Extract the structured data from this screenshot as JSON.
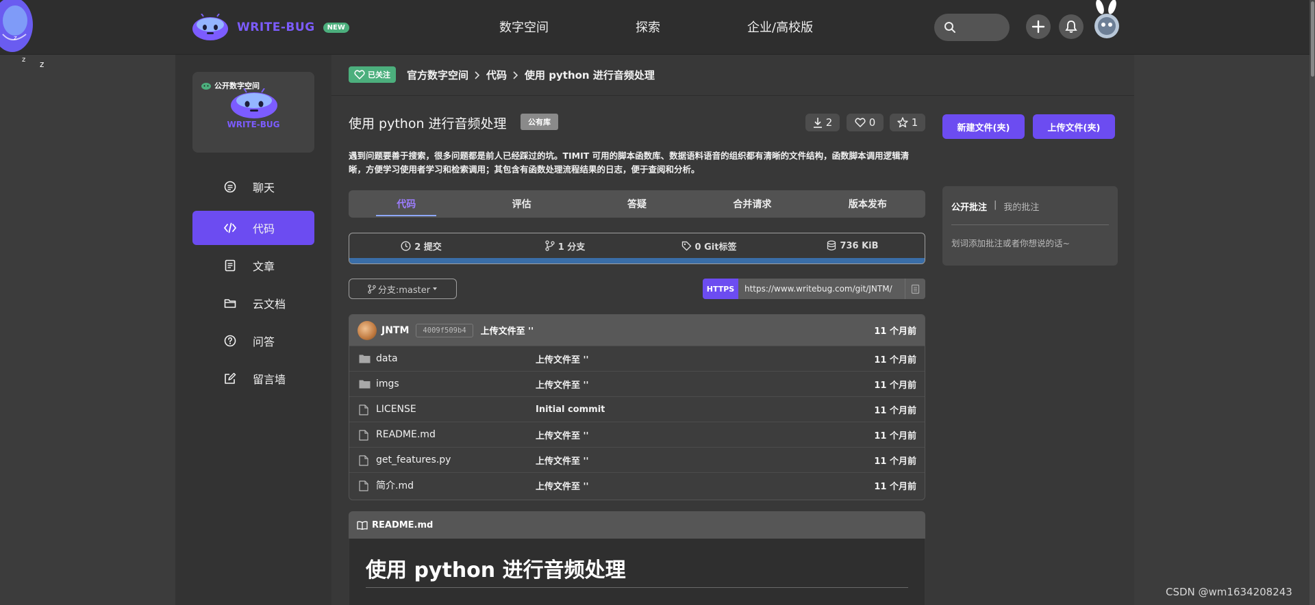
{
  "header": {
    "logo_text": "WRITE-BUG",
    "logo_badge": "NEW",
    "nav": [
      {
        "label": "数字空间"
      },
      {
        "label": "探索"
      },
      {
        "label": "企业/高校版"
      }
    ],
    "search_placeholder": "",
    "mascot_text": "Z z z"
  },
  "sidebar": {
    "space_tag": "公开数字空间",
    "space_name": "WRITE-BUG",
    "items": [
      {
        "label": "聊天",
        "icon": "chat-icon"
      },
      {
        "label": "代码",
        "icon": "code-icon",
        "active": true
      },
      {
        "label": "文章",
        "icon": "article-icon"
      },
      {
        "label": "云文档",
        "icon": "folder-icon"
      },
      {
        "label": "问答",
        "icon": "question-icon"
      },
      {
        "label": "留言墙",
        "icon": "edit-icon"
      }
    ]
  },
  "breadcrumb": {
    "follow_badge": "已关注",
    "items": [
      "官方数字空间",
      "代码",
      "使用 python 进行音频处理"
    ]
  },
  "repo": {
    "title": "使用 python 进行音频处理",
    "visibility": "公有库",
    "downloads": "2",
    "likes": "0",
    "stars": "1",
    "description": "遇到问题要善于搜索，很多问题都是前人已经踩过的坑。TIMIT 可用的脚本函数库、数据语料语音的组织都有清晰的文件结构，函数脚本调用逻辑清晰，方便学习使用者学习和检索调用；其包含有函数处理流程结果的日志，便于查阅和分析。"
  },
  "tabs": [
    {
      "label": "代码",
      "active": true
    },
    {
      "label": "评估"
    },
    {
      "label": "答疑"
    },
    {
      "label": "合并请求"
    },
    {
      "label": "版本发布"
    }
  ],
  "stats": {
    "commits": "2 提交",
    "branches": "1 分支",
    "tags": "0 Git标签",
    "size": "736 KiB"
  },
  "branch": {
    "label": "分支:master"
  },
  "clone": {
    "protocol": "HTTPS",
    "url": "https://www.writebug.com/git/JNTM/"
  },
  "latest_commit": {
    "author": "JNTM",
    "hash": "4009f509b4",
    "message": "上传文件至 ''",
    "time": "11 个月前"
  },
  "files": [
    {
      "name": "data",
      "type": "folder",
      "message": "上传文件至 ''",
      "time": "11 个月前"
    },
    {
      "name": "imgs",
      "type": "folder",
      "message": "上传文件至 ''",
      "time": "11 个月前"
    },
    {
      "name": "LICENSE",
      "type": "file",
      "message": "Initial commit",
      "time": "11 个月前"
    },
    {
      "name": "README.md",
      "type": "file",
      "message": "上传文件至 ''",
      "time": "11 个月前"
    },
    {
      "name": "get_features.py",
      "type": "file",
      "message": "上传文件至 ''",
      "time": "11 个月前"
    },
    {
      "name": "简介.md",
      "type": "file",
      "message": "上传文件至 ''",
      "time": "11 个月前"
    }
  ],
  "readme": {
    "filename": "README.md",
    "heading": "使用 python 进行音频处理"
  },
  "actions": {
    "new_file": "新建文件(夹)",
    "upload_file": "上传文件(夹)"
  },
  "notes": {
    "tab_public": "公开批注",
    "separator": "|",
    "tab_mine": "我的批注",
    "placeholder": "划词添加批注或者你想说的话~"
  },
  "watermark": "CSDN @wm1634208243",
  "colors": {
    "accent": "#6c4cf1",
    "follow_green": "#4caf7d",
    "progress_blue": "#3a6ea8"
  }
}
